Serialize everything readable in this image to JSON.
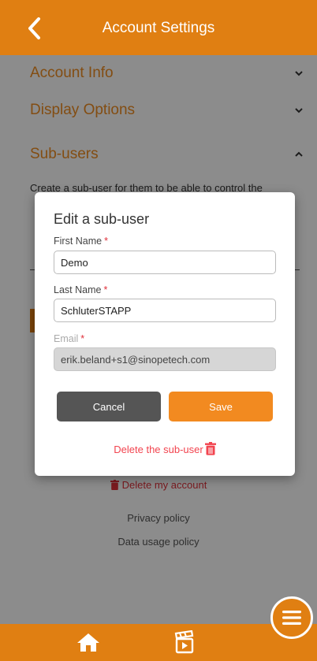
{
  "header": {
    "title": "Account Settings"
  },
  "sections": {
    "account_info": "Account Info",
    "display_options": "Display Options",
    "sub_users": "Sub-users"
  },
  "sub_users": {
    "description": "Create a sub-user for them to be able to control the"
  },
  "links": {
    "delete_account": "Delete my account",
    "privacy": "Privacy policy",
    "data_usage": "Data usage policy"
  },
  "modal": {
    "title": "Edit a sub-user",
    "first_name_label": "First Name",
    "first_name_value": "Demo",
    "last_name_label": "Last Name",
    "last_name_value": "SchluterSTAPP",
    "email_label": "Email",
    "email_value": "erik.beland+s1@sinopetech.com",
    "required_mark": "*",
    "cancel_label": "Cancel",
    "save_label": "Save",
    "delete_label": "Delete the sub-user"
  },
  "colors": {
    "brand": "#e07f12",
    "accent": "#f28a20",
    "danger": "#e0303a"
  },
  "icons": {
    "back": "chevron-left-icon",
    "chevron_down": "chevron-down-icon",
    "chevron_up": "chevron-up-icon",
    "trash": "trash-icon",
    "home": "home-icon",
    "clapperboard": "clapperboard-icon",
    "menu": "hamburger-menu-icon"
  }
}
